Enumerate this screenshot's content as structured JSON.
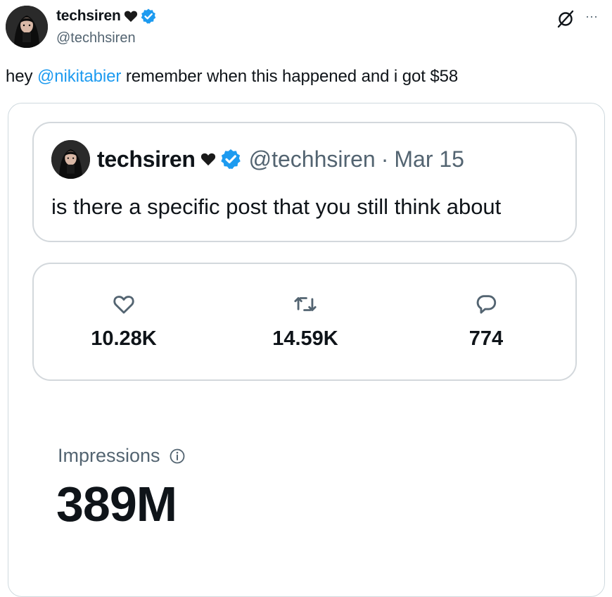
{
  "author": {
    "display_name": "techsiren",
    "handle": "@techhsiren",
    "verified_icon": "verified-badge-icon",
    "heart_icon": "heart-emoji-icon"
  },
  "header_actions": {
    "grok_icon": "grok-icon",
    "more_icon": "more-icon",
    "more_label": "···"
  },
  "tweet": {
    "text_before": "hey ",
    "mention": "@nikitabier",
    "text_after": " remember when this happened and i got $58"
  },
  "quoted_post": {
    "display_name": "techsiren",
    "handle": "@techhsiren",
    "separator": "·",
    "date": "Mar 15",
    "text": "is there a specific post that you still think about"
  },
  "stats": {
    "likes": "10.28K",
    "reposts": "14.59K",
    "replies": "774"
  },
  "impressions": {
    "label": "Impressions",
    "value": "389M"
  },
  "colors": {
    "accent": "#1d9bf0",
    "text_primary": "#0f1419",
    "text_secondary": "#536471",
    "border": "#cfd9de"
  }
}
